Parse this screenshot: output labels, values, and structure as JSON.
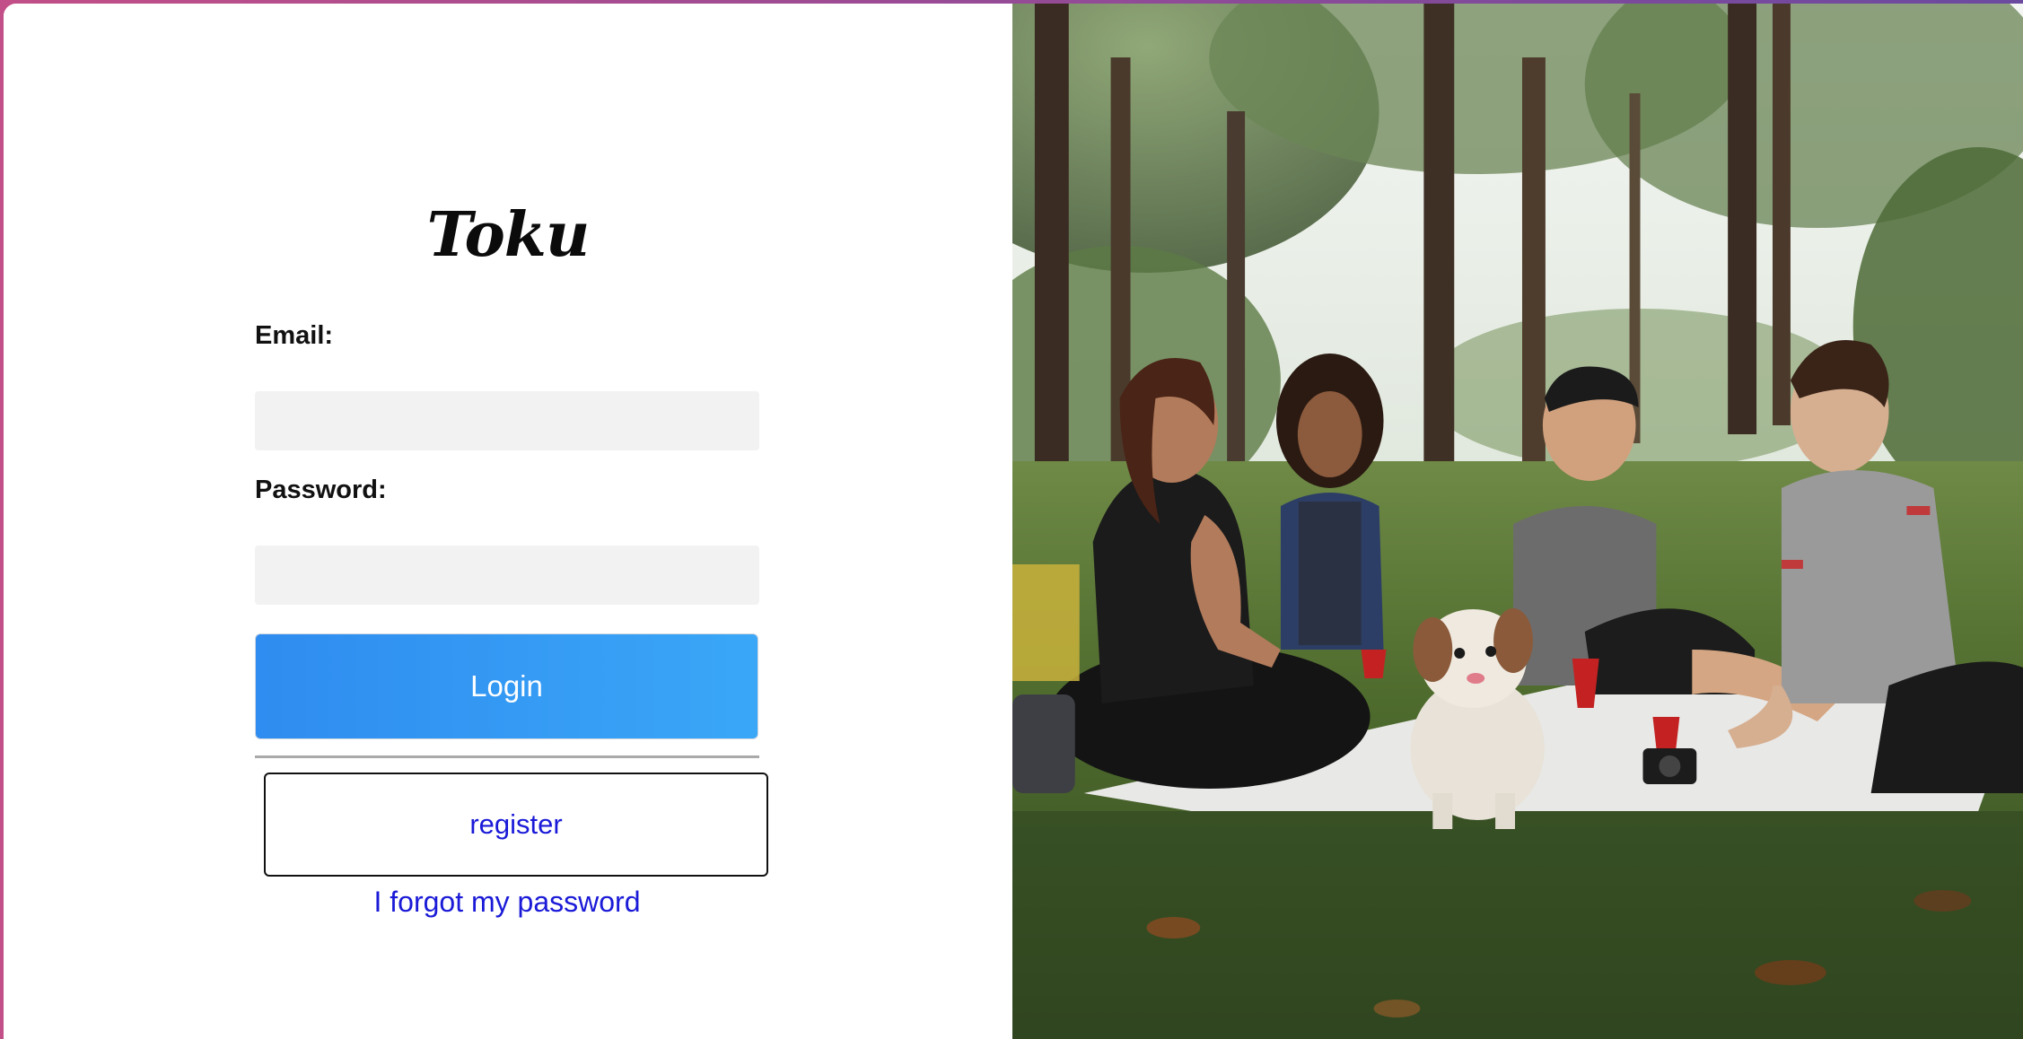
{
  "logo": {
    "text": "Toku"
  },
  "form": {
    "email_label": "Email:",
    "email_value": "",
    "password_label": "Password:",
    "password_value": "",
    "login_label": "Login",
    "register_label": "register",
    "forgot_label": "I forgot my password"
  },
  "colors": {
    "accent_start": "#2f8cf0",
    "accent_end": "#3aa7f7",
    "link": "#1a1ad8",
    "input_bg": "#f2f2f2"
  },
  "hero_image": {
    "icon": "photo-picnic-friends-dog"
  }
}
